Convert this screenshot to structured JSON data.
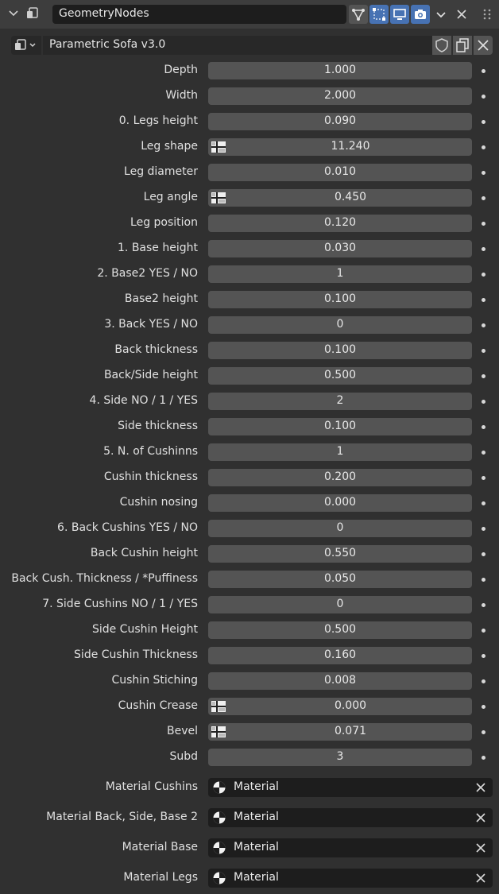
{
  "header": {
    "modifier_name": "GeometryNodes",
    "icons": [
      "chevron-down-icon",
      "geometry-nodes-icon",
      "node-tree-icon",
      "edit-mode-icon",
      "viewport-icon",
      "render-camera-icon",
      "chevron-down-icon",
      "close-icon",
      "drag-handle-icon"
    ]
  },
  "node_group": {
    "name": "Parametric Sofa v3.0",
    "icons": [
      "node-tree-type-icon",
      "fake-user-shield-icon",
      "duplicate-icon",
      "unlink-icon"
    ]
  },
  "inputs": [
    {
      "label": "Depth",
      "value": "1.000",
      "attribute": false
    },
    {
      "label": "Width",
      "value": "2.000",
      "attribute": false
    },
    {
      "label": "0. Legs height",
      "value": "0.090",
      "attribute": false
    },
    {
      "label": "Leg shape",
      "value": "11.240",
      "attribute": true
    },
    {
      "label": "Leg diameter",
      "value": "0.010",
      "attribute": false
    },
    {
      "label": "Leg angle",
      "value": "0.450",
      "attribute": true
    },
    {
      "label": "Leg position",
      "value": "0.120",
      "attribute": false
    },
    {
      "label": "1. Base height",
      "value": "0.030",
      "attribute": false
    },
    {
      "label": "2. Base2 YES / NO",
      "value": "1",
      "attribute": false
    },
    {
      "label": "Base2 height",
      "value": "0.100",
      "attribute": false
    },
    {
      "label": "3. Back YES / NO",
      "value": "0",
      "attribute": false
    },
    {
      "label": "Back thickness",
      "value": "0.100",
      "attribute": false
    },
    {
      "label": "Back/Side height",
      "value": "0.500",
      "attribute": false
    },
    {
      "label": "4. Side NO / 1 / YES",
      "value": "2",
      "attribute": false
    },
    {
      "label": "Side thickness",
      "value": "0.100",
      "attribute": false
    },
    {
      "label": "5. N. of Cushinns",
      "value": "1",
      "attribute": false
    },
    {
      "label": "Cushin thickness",
      "value": "0.200",
      "attribute": false
    },
    {
      "label": "Cushin nosing",
      "value": "0.000",
      "attribute": false
    },
    {
      "label": "6. Back Cushins YES / NO",
      "value": "0",
      "attribute": false
    },
    {
      "label": "Back Cushin height",
      "value": "0.550",
      "attribute": false
    },
    {
      "label": "Back Cush. Thickness / *Puffiness",
      "value": "0.050",
      "attribute": false
    },
    {
      "label": "7. Side Cushins NO / 1 / YES",
      "value": "0",
      "attribute": false
    },
    {
      "label": "Side Cushin Height",
      "value": "0.500",
      "attribute": false
    },
    {
      "label": "Side Cushin Thickness",
      "value": "0.160",
      "attribute": false
    },
    {
      "label": "Cushin Stiching",
      "value": "0.008",
      "attribute": false
    },
    {
      "label": "Cushin Crease",
      "value": "0.000",
      "attribute": true
    },
    {
      "label": "Bevel",
      "value": "0.071",
      "attribute": true
    },
    {
      "label": "Subd",
      "value": "3",
      "attribute": false
    }
  ],
  "materials": [
    {
      "label": "Material Cushins",
      "value": "Material"
    },
    {
      "label": "Material Back, Side, Base 2",
      "value": "Material"
    },
    {
      "label": "Material Base",
      "value": "Material"
    },
    {
      "label": "Material Legs",
      "value": "Material"
    }
  ],
  "colors": {
    "panel_bg": "#303030",
    "header_bg": "#3d3d3d",
    "field_bg": "#545454",
    "text_field_bg": "#1d1d1d",
    "accent_blue": "#4772b3"
  }
}
